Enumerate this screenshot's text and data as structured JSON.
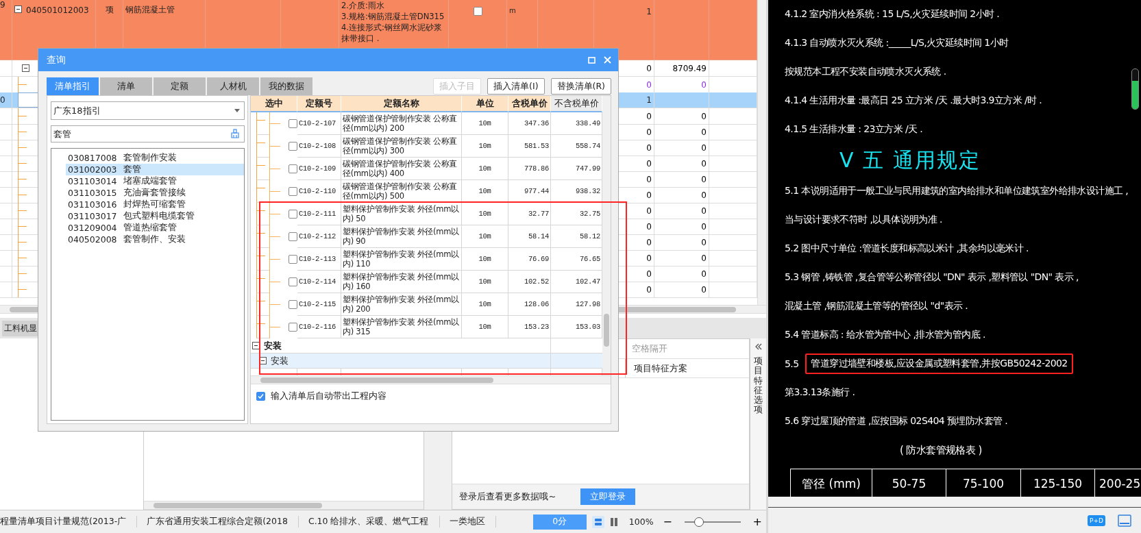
{
  "grid": {
    "rows": [
      {
        "kind": "item",
        "num": "9",
        "expanded": true,
        "code": "040501012003",
        "type": "项",
        "name": "钢筋混凝土管",
        "features": [
          "2.介质:雨水",
          "3.规格:钢筋混凝土管DN315",
          "4.连接形式:钢丝网水泥砂浆抹带接口 ."
        ],
        "checked": false,
        "unit": "m",
        "qty": "1",
        "selected": false
      },
      {
        "kind": "group",
        "expanded": true,
        "qty": "0",
        "amount": "8709.49",
        "selected": false,
        "color": "#000000"
      },
      {
        "kind": "detail",
        "qty": "0",
        "amount": "0",
        "selected": false,
        "color": "#8b2be2"
      },
      {
        "kind": "detail",
        "num": "0",
        "qty": "1",
        "selected": true
      },
      {
        "kind": "detail",
        "qty": "0",
        "amount": "0",
        "selected": false,
        "color": "#000000"
      },
      {
        "kind": "detail",
        "qty": "0",
        "amount": "0",
        "selected": false,
        "color": "#000000"
      },
      {
        "kind": "detail",
        "qty": "0",
        "amount": "0",
        "selected": false,
        "color": "#000000"
      },
      {
        "kind": "detail",
        "qty": "0",
        "amount": "0",
        "selected": false,
        "color": "#000000"
      },
      {
        "kind": "detail",
        "qty": "0",
        "amount": "0",
        "selected": false,
        "color": "#000000"
      },
      {
        "kind": "detail",
        "qty": "0",
        "amount": "0",
        "selected": false,
        "color": "#000000"
      },
      {
        "kind": "detail",
        "qty": "0",
        "amount": "0",
        "selected": false,
        "color": "#000000"
      },
      {
        "kind": "detail",
        "qty": "0",
        "amount": "0",
        "selected": false,
        "color": "#000000"
      },
      {
        "kind": "detail",
        "qty": "0",
        "amount": "0",
        "selected": false,
        "color": "#000000"
      },
      {
        "kind": "detail",
        "qty": "0",
        "amount": "0",
        "selected": false,
        "color": "#000000"
      },
      {
        "kind": "detail",
        "qty": "0",
        "amount": "0",
        "selected": false,
        "color": "#000000"
      },
      {
        "kind": "detail",
        "qty": "0",
        "amount": "0",
        "selected": false,
        "color": "#000000"
      }
    ]
  },
  "bottom_tab": {
    "label": "工料机显"
  },
  "feature_panel": {
    "hint": "空格隔开",
    "column": "项目特征方案",
    "login_text": "登录后查看更多数据哦~",
    "login_button": "立即登录",
    "side_tab": "项目特征选项"
  },
  "status_bar": {
    "items": [
      "程量清单项目计量规范(2013-广",
      "广东省通用安装工程综合定额(2018",
      "C.10 给排水、采暖、燃气工程",
      "一类地区"
    ],
    "score_button": "0分",
    "zoom": "100%",
    "minus": "−",
    "plus": "+",
    "zoom_slider": {
      "level": 0.25
    }
  },
  "dialog": {
    "title": "查询",
    "tabs": [
      {
        "label": "清单指引",
        "selected": true
      },
      {
        "label": "清单",
        "selected": false
      },
      {
        "label": "定额",
        "selected": false
      },
      {
        "label": "人材机",
        "selected": false
      },
      {
        "label": "我的数据",
        "selected": false
      }
    ],
    "buttons": [
      {
        "label": "插入子目",
        "disabled": true
      },
      {
        "label": "插入清单(I)",
        "disabled": false
      },
      {
        "label": "替换清单(R)",
        "disabled": false
      }
    ],
    "guide_select": "广东18指引",
    "search_value": "套管",
    "guide_items": [
      {
        "code": "030817008",
        "name": "套管制作安装",
        "selected": false
      },
      {
        "code": "031002003",
        "name": "套管",
        "selected": true
      },
      {
        "code": "031103014",
        "name": "堵塞成端套管",
        "selected": false
      },
      {
        "code": "031103015",
        "name": "充油膏套管接续",
        "selected": false
      },
      {
        "code": "031103016",
        "name": "封焊热可缩套管",
        "selected": false
      },
      {
        "code": "031103017",
        "name": "包式塑料电缆套管",
        "selected": false
      },
      {
        "code": "031209004",
        "name": "管道热缩套管",
        "selected": false
      },
      {
        "code": "040502008",
        "name": "套管制作、安装",
        "selected": false
      }
    ],
    "table": {
      "columns": [
        {
          "label": "选中",
          "highlighted": true
        },
        {
          "label": "定额号",
          "highlighted": true
        },
        {
          "label": "定额名称",
          "highlighted": true
        },
        {
          "label": "单位",
          "highlighted": true
        },
        {
          "label": "含税单价",
          "highlighted": true
        },
        {
          "label": "不含税单价",
          "highlighted": false
        }
      ],
      "rows": [
        {
          "kind": "quota",
          "checked": false,
          "code": "C10-2-107",
          "name": "碳钢管道保护管制作安装 公称直径(mm以内) 200",
          "unit": "10m",
          "price_tax": "347.36",
          "price_notax": "338.49"
        },
        {
          "kind": "quota",
          "checked": false,
          "code": "C10-2-108",
          "name": "碳钢管道保护管制作安装 公称直径(mm以内) 300",
          "unit": "10m",
          "price_tax": "581.53",
          "price_notax": "558.74"
        },
        {
          "kind": "quota",
          "checked": false,
          "code": "C10-2-109",
          "name": "碳钢管道保护管制作安装 公称直径(mm以内) 400",
          "unit": "10m",
          "price_tax": "778.86",
          "price_notax": "747.99"
        },
        {
          "kind": "quota",
          "checked": false,
          "code": "C10-2-110",
          "name": "碳钢管道保护管制作安装 公称直径(mm以内) 500",
          "unit": "10m",
          "price_tax": "977.44",
          "price_notax": "938.32"
        },
        {
          "kind": "quota",
          "checked": false,
          "code": "C10-2-111",
          "name": "塑料保护管制作安装 外径(mm以内) 50",
          "unit": "10m",
          "price_tax": "32.77",
          "price_notax": "32.75"
        },
        {
          "kind": "quota",
          "checked": false,
          "code": "C10-2-112",
          "name": "塑料保护管制作安装 外径(mm以内) 90",
          "unit": "10m",
          "price_tax": "58.14",
          "price_notax": "58.12"
        },
        {
          "kind": "quota",
          "checked": false,
          "code": "C10-2-113",
          "name": "塑料保护管制作安装 外径(mm以内) 110",
          "unit": "10m",
          "price_tax": "76.69",
          "price_notax": "76.65"
        },
        {
          "kind": "quota",
          "checked": false,
          "code": "C10-2-114",
          "name": "塑料保护管制作安装 外径(mm以内) 160",
          "unit": "10m",
          "price_tax": "102.52",
          "price_notax": "102.47"
        },
        {
          "kind": "quota",
          "checked": false,
          "code": "C10-2-115",
          "name": "塑料保护管制作安装 外径(mm以内) 200",
          "unit": "10m",
          "price_tax": "128.06",
          "price_notax": "127.98"
        },
        {
          "kind": "quota",
          "checked": false,
          "code": "C10-2-116",
          "name": "塑料保护管制作安装 外径(mm以内) 315",
          "unit": "10m",
          "price_tax": "153.23",
          "price_notax": "153.03"
        },
        {
          "kind": "group",
          "label": "安装",
          "expanded": true
        },
        {
          "kind": "subgroup",
          "label": "安装",
          "expanded": true
        }
      ]
    },
    "auto_content": {
      "label": "输入清单后自动带出工程内容",
      "checked": true
    }
  },
  "drawing": {
    "lines": [
      {
        "kind": "text",
        "text": "4.1.2  室内消火栓系统 : 15  L/S,火灾延续时间 2小时 ."
      },
      {
        "kind": "text",
        "text": "4.1.3  自动喷水灭火系统 :_____L/S,火灾延续时间 1小时"
      },
      {
        "kind": "text",
        "text": "按规范本工程不安装自动喷水灭火系统 ."
      },
      {
        "kind": "text",
        "text": "4.1.4  生活用水量 :最高日 25  立方米 /天 .最大时3.9立方米 /时 ."
      },
      {
        "kind": "text",
        "text": "4.1.5  生活排水量 : 23立方米 /天 ."
      },
      {
        "kind": "heading",
        "text": "V  五  通用规定"
      },
      {
        "kind": "text",
        "text": "5.1  本说明适用于一般工业与民用建筑的室内给排水和单位建筑室外给排水设计施工 ,"
      },
      {
        "kind": "text",
        "text": "当与设计要求不符时 ,以具体说明为准 ."
      },
      {
        "kind": "text",
        "text": "5.2  图中尺寸单位 :管道长度和标高以米计 ,其余均以毫米计 ."
      },
      {
        "kind": "text",
        "text": "5.3  钢管 ,铸铁管 ,复合管等公称管径以 \"DN\" 表示 ,塑料管以 \"DN\" 表示 ,"
      },
      {
        "kind": "text",
        "text": "混凝土管 ,钢筋混凝土管等的管径以 \"d\"表示 ."
      },
      {
        "kind": "text",
        "text": "5.4  管道标高 : 给水管为管中心 ,排水管为管内底 ."
      },
      {
        "kind": "boxed",
        "number": "5.5",
        "text": "管道穿过墙壁和楼板,应设金属或塑料套管,并按GB50242-2002"
      },
      {
        "kind": "text",
        "text": "第3.3.13条施行 ."
      },
      {
        "kind": "text",
        "text": "5.6  穿过屋顶的管道 ,应按国标 02S404  预埋防水套管 ."
      },
      {
        "kind": "caption",
        "text": "( 防水套管规格表 )"
      }
    ],
    "spec_table": [
      "管径 (mm)",
      "50-75",
      "75-100",
      "125-150",
      "200-25"
    ],
    "badge": "P+D"
  }
}
